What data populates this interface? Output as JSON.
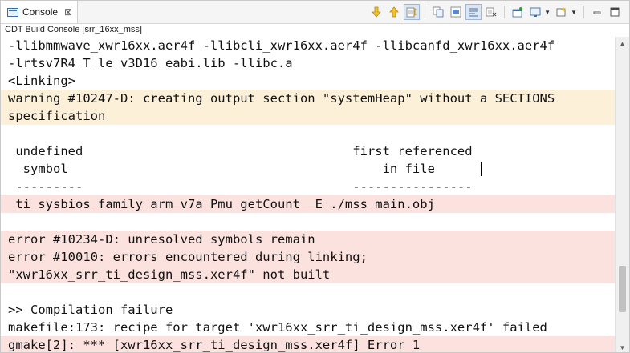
{
  "tab": {
    "label": "Console",
    "close": "⊠"
  },
  "subtitle": "CDT Build Console [srr_16xx_mss]",
  "toolbar": {
    "icons": [
      "scroll-down-icon",
      "scroll-up-icon",
      "scroll-lock-icon",
      "copy-icon",
      "select-all-icon",
      "word-wrap-icon",
      "clear-console-icon",
      "pin-console-icon",
      "display-console-icon",
      "open-console-icon",
      "minimize-icon",
      "maximize-icon"
    ]
  },
  "console": {
    "lines": [
      {
        "text": "-llibmmwave_xwr16xx.aer4f -llibcli_xwr16xx.aer4f -llibcanfd_xwr16xx.aer4f",
        "kind": "normal"
      },
      {
        "text": "-lrtsv7R4_T_le_v3D16_eabi.lib -llibc.a",
        "kind": "normal"
      },
      {
        "text": "<Linking>",
        "kind": "normal"
      },
      {
        "text": "warning #10247-D: creating output section \"systemHeap\" without a SECTIONS",
        "kind": "warn"
      },
      {
        "text": "specification",
        "kind": "warn"
      },
      {
        "text": "",
        "kind": "normal"
      },
      {
        "text": " undefined                                    first referenced",
        "kind": "normal"
      },
      {
        "text": "  symbol                                          in file",
        "kind": "normal"
      },
      {
        "text": " ---------                                    ----------------",
        "kind": "normal"
      },
      {
        "text": " ti_sysbios_family_arm_v7a_Pmu_getCount__E ./mss_main.obj",
        "kind": "err"
      },
      {
        "text": "",
        "kind": "normal"
      },
      {
        "text": "error #10234-D: unresolved symbols remain",
        "kind": "err"
      },
      {
        "text": "error #10010: errors encountered during linking;",
        "kind": "err"
      },
      {
        "text": "\"xwr16xx_srr_ti_design_mss.xer4f\" not built",
        "kind": "err"
      },
      {
        "text": "",
        "kind": "normal"
      },
      {
        "text": ">> Compilation failure",
        "kind": "normal"
      },
      {
        "text": "makefile:173: recipe for target 'xwr16xx_srr_ti_design_mss.xer4f' failed",
        "kind": "normal"
      },
      {
        "text": "gmake[2]: *** [xwr16xx_srr_ti_design_mss.xer4f] Error 1",
        "kind": "err"
      }
    ]
  },
  "colors": {
    "warning_bg": "#fcf0d8",
    "error_bg": "#fbe2de",
    "text": "#111111"
  }
}
